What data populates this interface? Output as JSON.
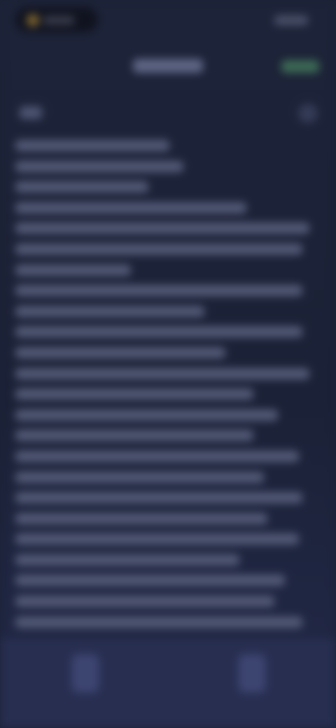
{
  "status_bar": {
    "time": "",
    "indicator_icon": "recording-dot-icon",
    "system_icons": "signal-wifi-battery-icons"
  },
  "nav_bar": {
    "back_icon": "chevron-left-icon",
    "title": "",
    "done_label": ""
  },
  "toolbar": {
    "format_icon": "text-format-icon",
    "more_icon": "more-icon"
  },
  "note": {
    "blurred": true,
    "line_count": 24
  },
  "bottom_bar": {
    "left_icon": "checklist-icon",
    "right_icon": "compose-icon"
  },
  "colors": {
    "background": "#1c2236",
    "accent": "#3c6a55",
    "bottom_bar": "#272e50"
  }
}
